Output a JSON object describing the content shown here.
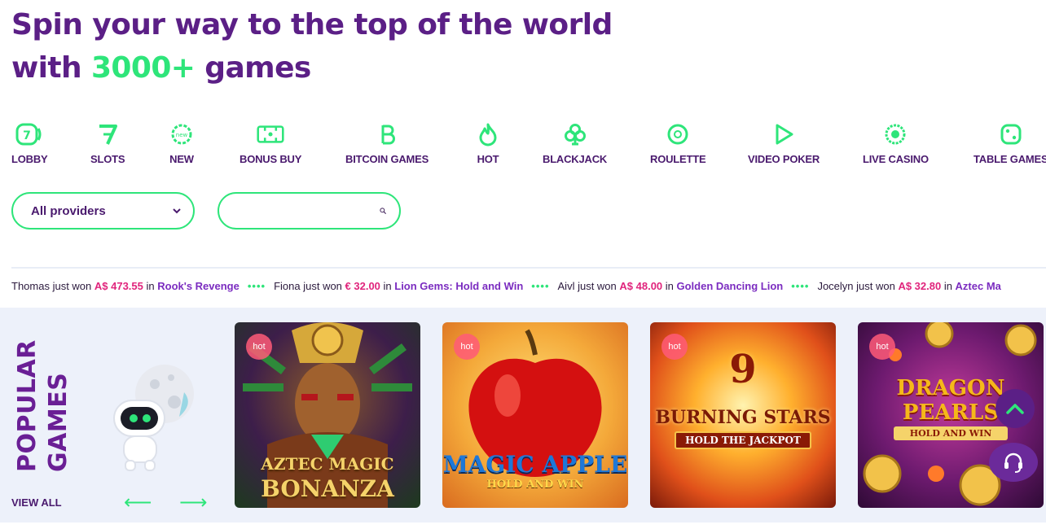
{
  "hero": {
    "line1": "Spin your way to the top of the world",
    "line2_prefix": "with ",
    "line2_accent": "3000+",
    "line2_suffix": " games"
  },
  "categories": [
    {
      "label": "LOBBY",
      "icon": "lobby-icon"
    },
    {
      "label": "SLOTS",
      "icon": "slots-icon"
    },
    {
      "label": "NEW",
      "icon": "new-icon"
    },
    {
      "label": "BONUS BUY",
      "icon": "bonus-buy-icon"
    },
    {
      "label": "BITCOIN GAMES",
      "icon": "bitcoin-icon"
    },
    {
      "label": "HOT",
      "icon": "flame-icon"
    },
    {
      "label": "BLACKJACK",
      "icon": "club-icon"
    },
    {
      "label": "ROULETTE",
      "icon": "roulette-icon"
    },
    {
      "label": "VIDEO POKER",
      "icon": "play-icon"
    },
    {
      "label": "LIVE CASINO",
      "icon": "live-casino-icon"
    },
    {
      "label": "TABLE GAMES",
      "icon": "dice-icon"
    }
  ],
  "filters": {
    "provider_value": "All providers",
    "search_placeholder": ""
  },
  "ticker": [
    {
      "name": "Thomas",
      "text": " just won ",
      "amount": "A$ 473.55",
      "in": " in ",
      "game": "Rook's Revenge"
    },
    {
      "name": "Fiona",
      "text": " just won ",
      "amount": "€ 32.00",
      "in": " in ",
      "game": "Lion Gems: Hold and Win"
    },
    {
      "name": "Aivl",
      "text": " just won ",
      "amount": "A$ 48.00",
      "in": " in ",
      "game": "Golden Dancing Lion"
    },
    {
      "name": "Jocelyn",
      "text": " just won ",
      "amount": "A$ 32.80",
      "in": " in ",
      "game": "Aztec Ma"
    }
  ],
  "ticker_separator": "••••",
  "popular": {
    "title_line1": "POPULAR",
    "title_line2": "GAMES",
    "view_all": "VIEW ALL",
    "prev_arrow": "⟵",
    "next_arrow": "⟶",
    "games": [
      {
        "badge": "hot",
        "line1": "AZTEC MAGIC",
        "line2": "BONANZA"
      },
      {
        "badge": "hot",
        "line1": "MAGIC APPLE",
        "line2": "HOLD AND WIN"
      },
      {
        "badge": "hot",
        "line0": "9",
        "line1": "BURNING STARS",
        "line2": "HOLD THE JACKPOT"
      },
      {
        "badge": "hot",
        "line1": "DRAGON PEARLS",
        "line2": "HOLD AND WIN"
      }
    ]
  },
  "colors": {
    "brand_purple": "#5b1f86",
    "accent_green": "#2ee57a",
    "amount_pink": "#e0247c",
    "game_purple": "#7b2cc0",
    "section_bg": "#edf1fa"
  }
}
